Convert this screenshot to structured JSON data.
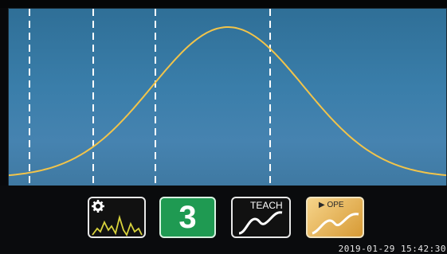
{
  "colors": {
    "plot_background": "#3a7eaa",
    "curve": "#f2c44a",
    "guide_lines": "#ffffff",
    "program_button": "#1f9a52",
    "operate_button": "#e6b45a"
  },
  "toolbar": {
    "settings_chart_icon": "gear-waveform-icon",
    "program_number": "3",
    "teach_label": "TEACH",
    "operate_label": "▶ OPE"
  },
  "status": {
    "timestamp": "2019-01-29 15:42:30"
  }
}
